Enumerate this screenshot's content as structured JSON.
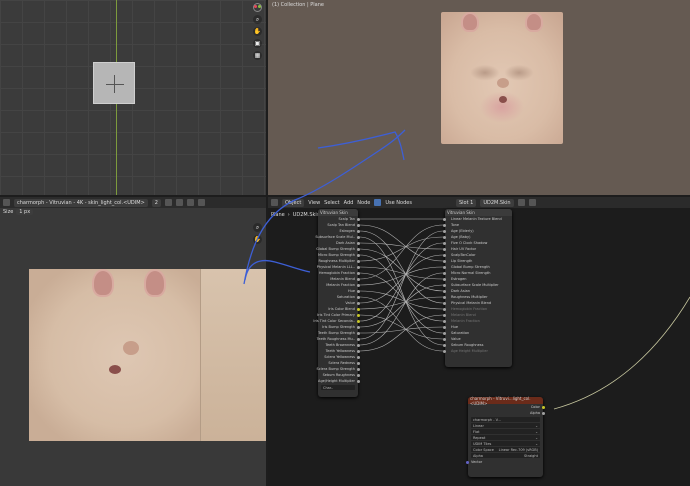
{
  "viewport3d": {
    "icons": [
      "gizmo-icon",
      "zoom-icon",
      "hand-icon"
    ]
  },
  "render_view": {
    "title": "(1) Collection | Plane"
  },
  "uv_editor": {
    "image_name": "charmorph - Vitruvian - 4K - skin_light_col.<UDIM>",
    "slot_count": "2",
    "size_label": "Size",
    "size_value": "1 px",
    "icons": [
      "zoom-icon",
      "hand-icon"
    ]
  },
  "node_editor": {
    "mode": "Object",
    "menu": [
      "View",
      "Select",
      "Add",
      "Node"
    ],
    "use_nodes": "Use Nodes",
    "slot": "Slot 1",
    "material": "UD2M.Skin",
    "breadcrumb": [
      "Plane",
      "UD2M.Skin"
    ],
    "group_node": {
      "title": "Vitruvian Skin",
      "inputs": [
        "Scalp Tan",
        "Scalp Tan Blend",
        "Estrogen",
        "Subsurface Scale Mul..",
        "Dark Asian",
        "Global Bump Strength",
        "Micro Bump Strength",
        "Roughness Multiplier",
        "Physical Melanin LLL..",
        "Hemoglobin Fraction",
        "Melanin Blend",
        "Melanin Fraction",
        "Hue",
        "Saturation",
        "Value",
        "Iris Color Blend",
        "Iris Tint Color Primary",
        "Iris Tint Color Seconda..",
        "Iris Bump Strength",
        "Teeth Bump Strength",
        "Teeth Roughness Mu..",
        "Teeth Brownness",
        "Teeth Yellowness",
        "Sclera Yellowness",
        "Sclera Redness",
        "Sclera Bump Strength",
        "Sebum Roughness",
        "Age/Height Multiplier"
      ],
      "footer": "Char.."
    },
    "out_node": {
      "title": "Vitruvian Skin",
      "inputs": [
        "Linear Melanin Texture Blend",
        "Tone",
        "Age (Elderly)",
        "Age (Baby)",
        "Five O Clock Shadow",
        "Hair UV Factor",
        "ScalpTanColor",
        "Lip Strength",
        "Global Bump Strength",
        "Micro Normal Strength",
        "Estrogen",
        "Subsurface Scale Multiplier",
        "Dark Asian",
        "Roughness Multiplier",
        "Physical Melanin Blend",
        "Hemoglobin Fraction",
        "Melanin Blend",
        "Melanin Fraction",
        "Hue",
        "Saturation",
        "Value",
        "Sebum Roughness",
        "Age Height Multiplier"
      ],
      "dim_indices": [
        15,
        16,
        17,
        22
      ]
    },
    "image_node": {
      "title": "charmorph - Vitruvi...light_col.<UDIM>",
      "outputs": [
        "Color",
        "Alpha"
      ],
      "image_name": "charmorph - V...",
      "interpolation": "Linear",
      "projection": "Flat",
      "extension": "Repeat",
      "source": "UDIM Tiles",
      "color_space_label": "Color Space",
      "color_space": "Linear Rec.709 (sRGB)",
      "alpha_label": "Alpha",
      "alpha": "Straight",
      "vector_label": "Vector"
    }
  }
}
